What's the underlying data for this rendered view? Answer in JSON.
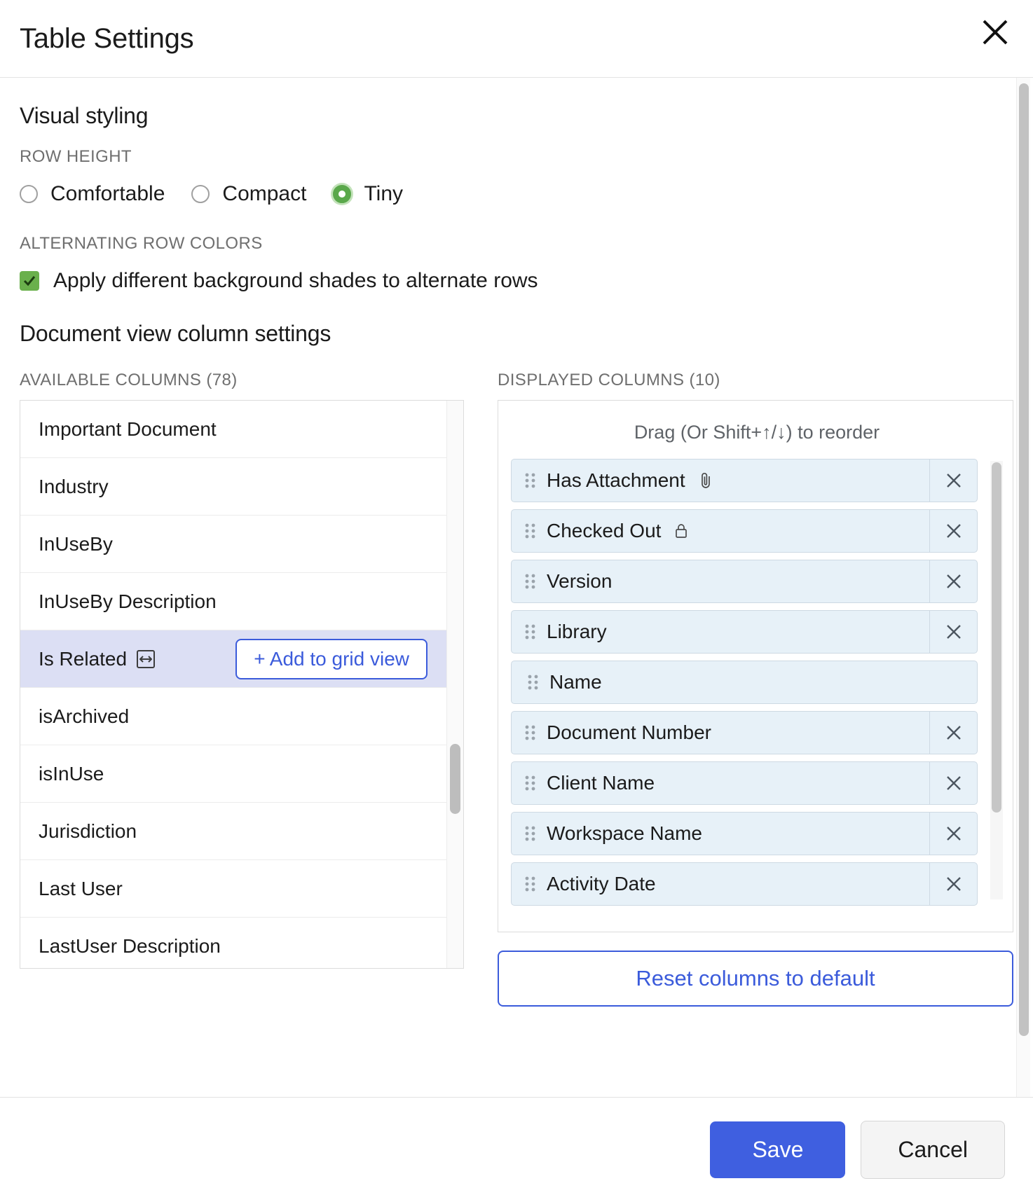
{
  "dialog": {
    "title": "Table Settings",
    "close_icon": "close-icon"
  },
  "visual_styling": {
    "heading": "Visual styling",
    "row_height": {
      "label": "ROW HEIGHT",
      "options": [
        {
          "label": "Comfortable",
          "selected": false
        },
        {
          "label": "Compact",
          "selected": false
        },
        {
          "label": "Tiny",
          "selected": true
        }
      ],
      "selected_value": "Tiny",
      "accent_color": "#5aa84b"
    },
    "alternating_row_colors": {
      "label": "ALTERNATING ROW COLORS",
      "checkbox_label": "Apply different background shades to alternate rows",
      "checked": true,
      "accent_color": "#6ab04c"
    }
  },
  "column_settings": {
    "heading": "Document view column settings",
    "available": {
      "label": "AVAILABLE COLUMNS (78)",
      "count": 78,
      "add_button_label": "+ Add to grid view",
      "items": [
        {
          "label": "Important Document",
          "selected": false,
          "icon": null
        },
        {
          "label": "Industry",
          "selected": false,
          "icon": null
        },
        {
          "label": "InUseBy",
          "selected": false,
          "icon": null
        },
        {
          "label": "InUseBy Description",
          "selected": false,
          "icon": null
        },
        {
          "label": "Is Related",
          "selected": true,
          "icon": "resize-horizontal-icon"
        },
        {
          "label": "isArchived",
          "selected": false,
          "icon": null
        },
        {
          "label": "isInUse",
          "selected": false,
          "icon": null
        },
        {
          "label": "Jurisdiction",
          "selected": false,
          "icon": null
        },
        {
          "label": "Last User",
          "selected": false,
          "icon": null
        },
        {
          "label": "LastUser Description",
          "selected": false,
          "icon": null
        }
      ]
    },
    "displayed": {
      "label": "DISPLAYED COLUMNS (10)",
      "count": 10,
      "drag_hint": "Drag (Or Shift+↑/↓) to reorder",
      "items": [
        {
          "label": "Has Attachment",
          "icon": "paperclip-icon",
          "removable": true
        },
        {
          "label": "Checked Out",
          "icon": "lock-icon",
          "removable": true
        },
        {
          "label": "Version",
          "icon": null,
          "removable": true
        },
        {
          "label": "Library",
          "icon": null,
          "removable": true
        },
        {
          "label": "Name",
          "icon": null,
          "removable": false
        },
        {
          "label": "Document Number",
          "icon": null,
          "removable": true
        },
        {
          "label": "Client Name",
          "icon": null,
          "removable": true
        },
        {
          "label": "Workspace Name",
          "icon": null,
          "removable": true
        },
        {
          "label": "Activity Date",
          "icon": null,
          "removable": true
        }
      ],
      "reset_label": "Reset columns to default"
    }
  },
  "footer": {
    "save_label": "Save",
    "cancel_label": "Cancel",
    "save_color": "#3f5fe0"
  }
}
